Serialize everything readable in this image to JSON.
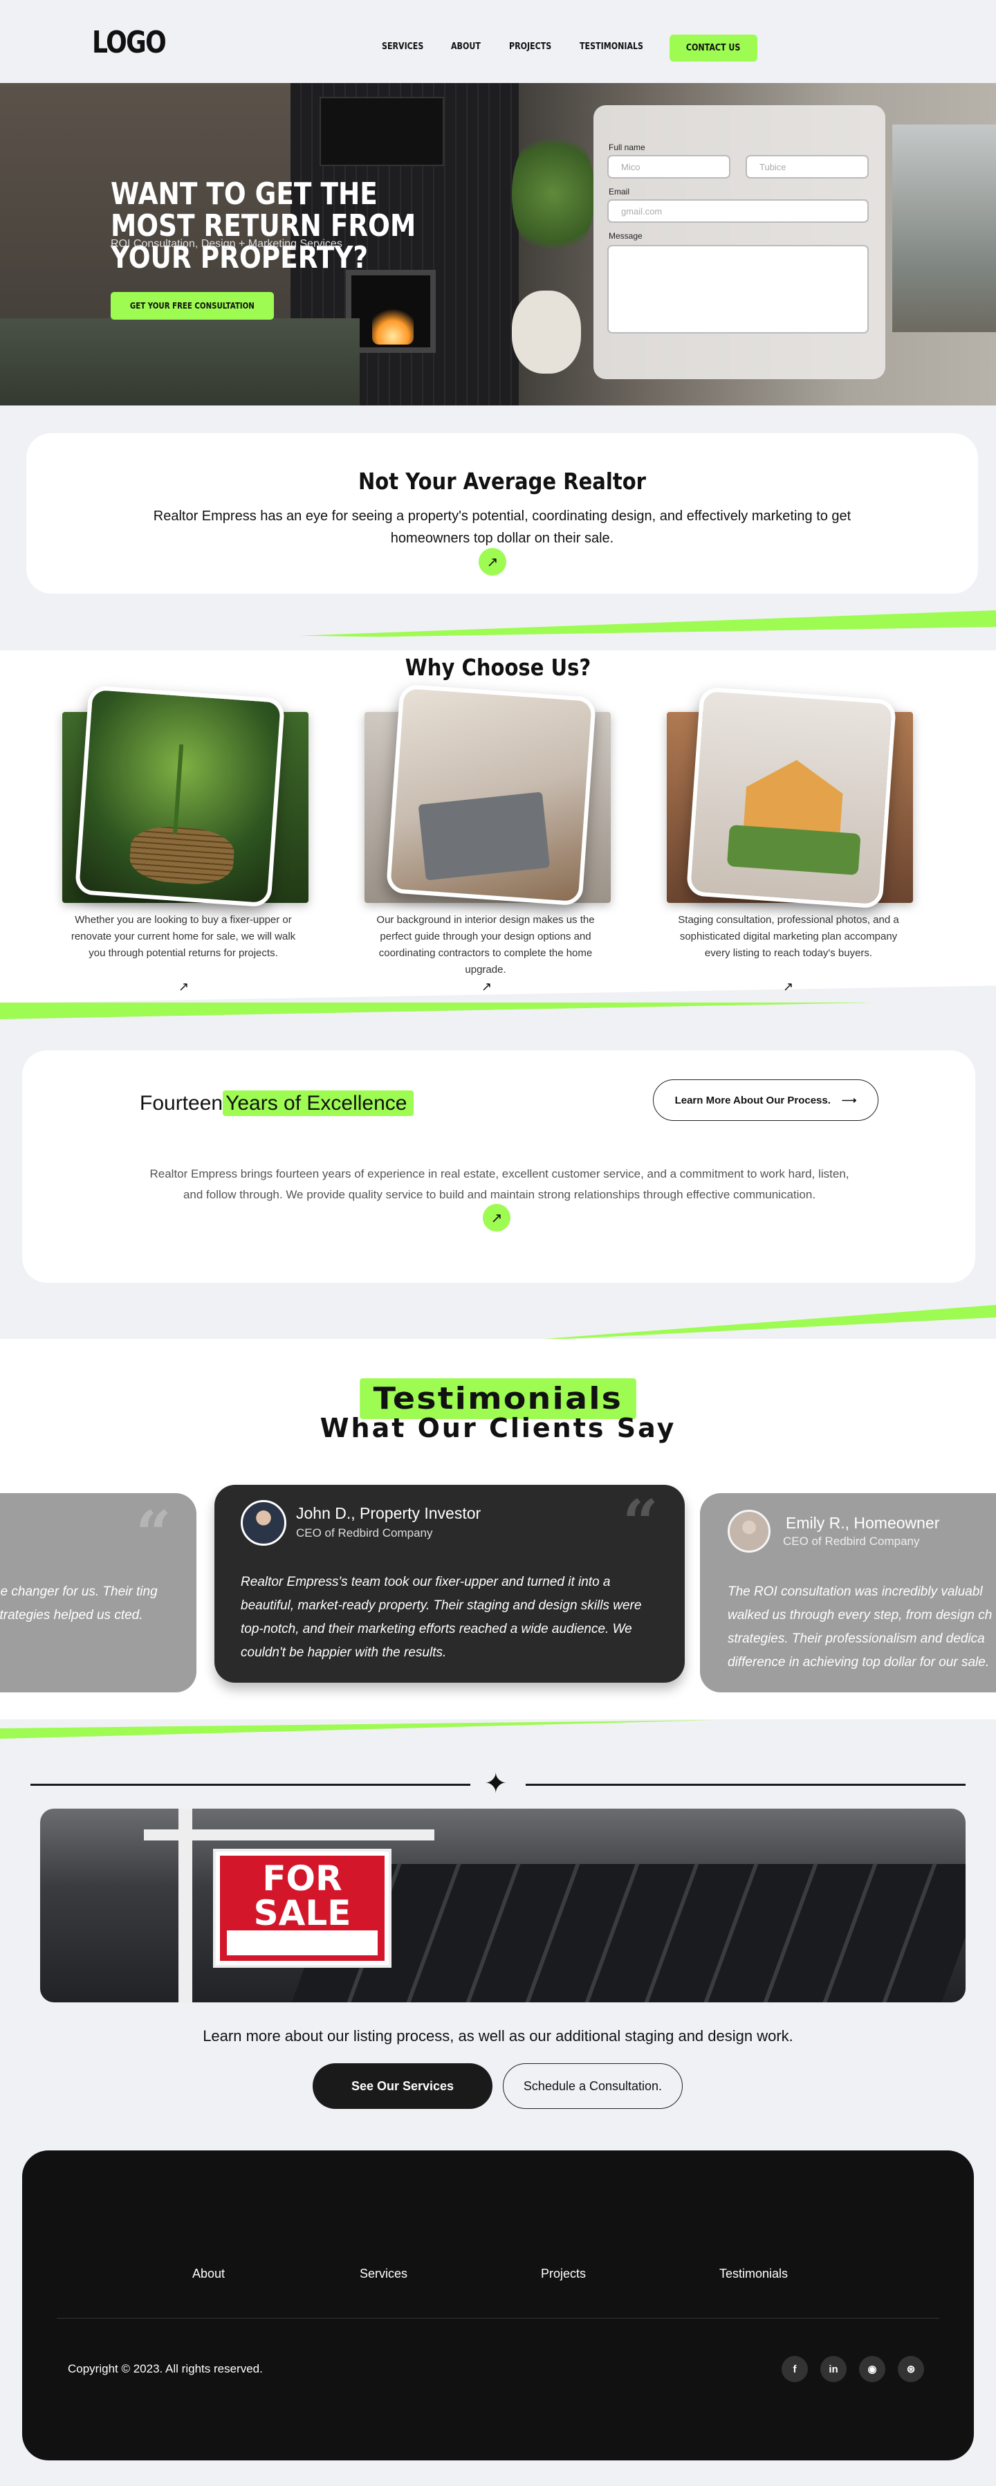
{
  "header": {
    "logo": "LOGO",
    "nav": [
      "SERVICES",
      "ABOUT",
      "PROJECTS",
      "TESTIMONIALS"
    ],
    "contact_label": "CONTACT US"
  },
  "hero": {
    "title": "WANT TO GET THE MOST RETURN FROM YOUR PROPERTY?",
    "subtitle": "ROI Consultation, Design + Marketing Services",
    "cta": "GET YOUR FREE CONSULTATION",
    "form": {
      "full_name_label": "Full name",
      "first_placeholder": "Mico",
      "last_placeholder": "Tubice",
      "email_label": "Email",
      "email_placeholder": "gmail.com",
      "message_label": "Message"
    }
  },
  "realtor": {
    "title": "Not Your Average Realtor",
    "text": "Realtor Empress has an eye for seeing a property's potential, coordinating design, and effectively marketing to get homeowners top dollar on their sale."
  },
  "why": {
    "title": "Why Choose Us?",
    "items": [
      {
        "text": "Whether you are looking to buy a fixer-upper or renovate your current home for sale, we will walk you through potential returns for projects."
      },
      {
        "text": "Our background in interior design makes us the perfect guide through your design options and coordinating contractors to complete the home upgrade."
      },
      {
        "text": "Staging consultation, professional photos, and a sophisticated digital marketing plan accompany every listing to reach today's buyers."
      }
    ]
  },
  "years": {
    "title_plain": "Fourteen",
    "title_highlight": "Years of Excellence",
    "button": "Learn More About Our Process.",
    "text": "Realtor Empress brings fourteen years of experience in real estate, excellent customer service, and a commitment to work hard, listen, and follow through. We provide quality service to build and maintain strong relationships through effective communication."
  },
  "testimonials": {
    "title": "Testimonials",
    "subtitle": "What Our Clients Say",
    "left_partial": "ne changer for us. Their ting strategies helped us cted.",
    "main": {
      "name": "John D., Property Investor",
      "role": "CEO of Redbird Company",
      "quote": "Realtor Empress's team took our fixer-upper and turned it into a beautiful, market-ready property. Their staging and design skills were top-notch, and their marketing efforts reached a wide audience. We couldn't be happier with the results."
    },
    "right": {
      "name": "Emily R., Homeowner",
      "role": "CEO of Redbird Company",
      "quote": "The ROI consultation was incredibly valuabl walked us through every step, from design ch strategies. Their professionalism and dedica difference in achieving top dollar for our sale."
    }
  },
  "listing": {
    "sign_line1": "FOR",
    "sign_line2": "SALE",
    "text": "Learn more about our listing process, as well as our additional staging and design work.",
    "services_button": "See Our Services",
    "schedule_button": "Schedule a Consultation."
  },
  "footer": {
    "links": [
      "About",
      "Services",
      "Projects",
      "Testimonials"
    ],
    "copyright": "Copyright © 2023. All rights reserved.",
    "social_icons": [
      "facebook-icon",
      "linkedin-icon",
      "github-icon",
      "dribbble-icon"
    ]
  },
  "colors": {
    "accent": "#9dfb52",
    "dark": "#111111",
    "page_bg": "#f0f1f5"
  }
}
